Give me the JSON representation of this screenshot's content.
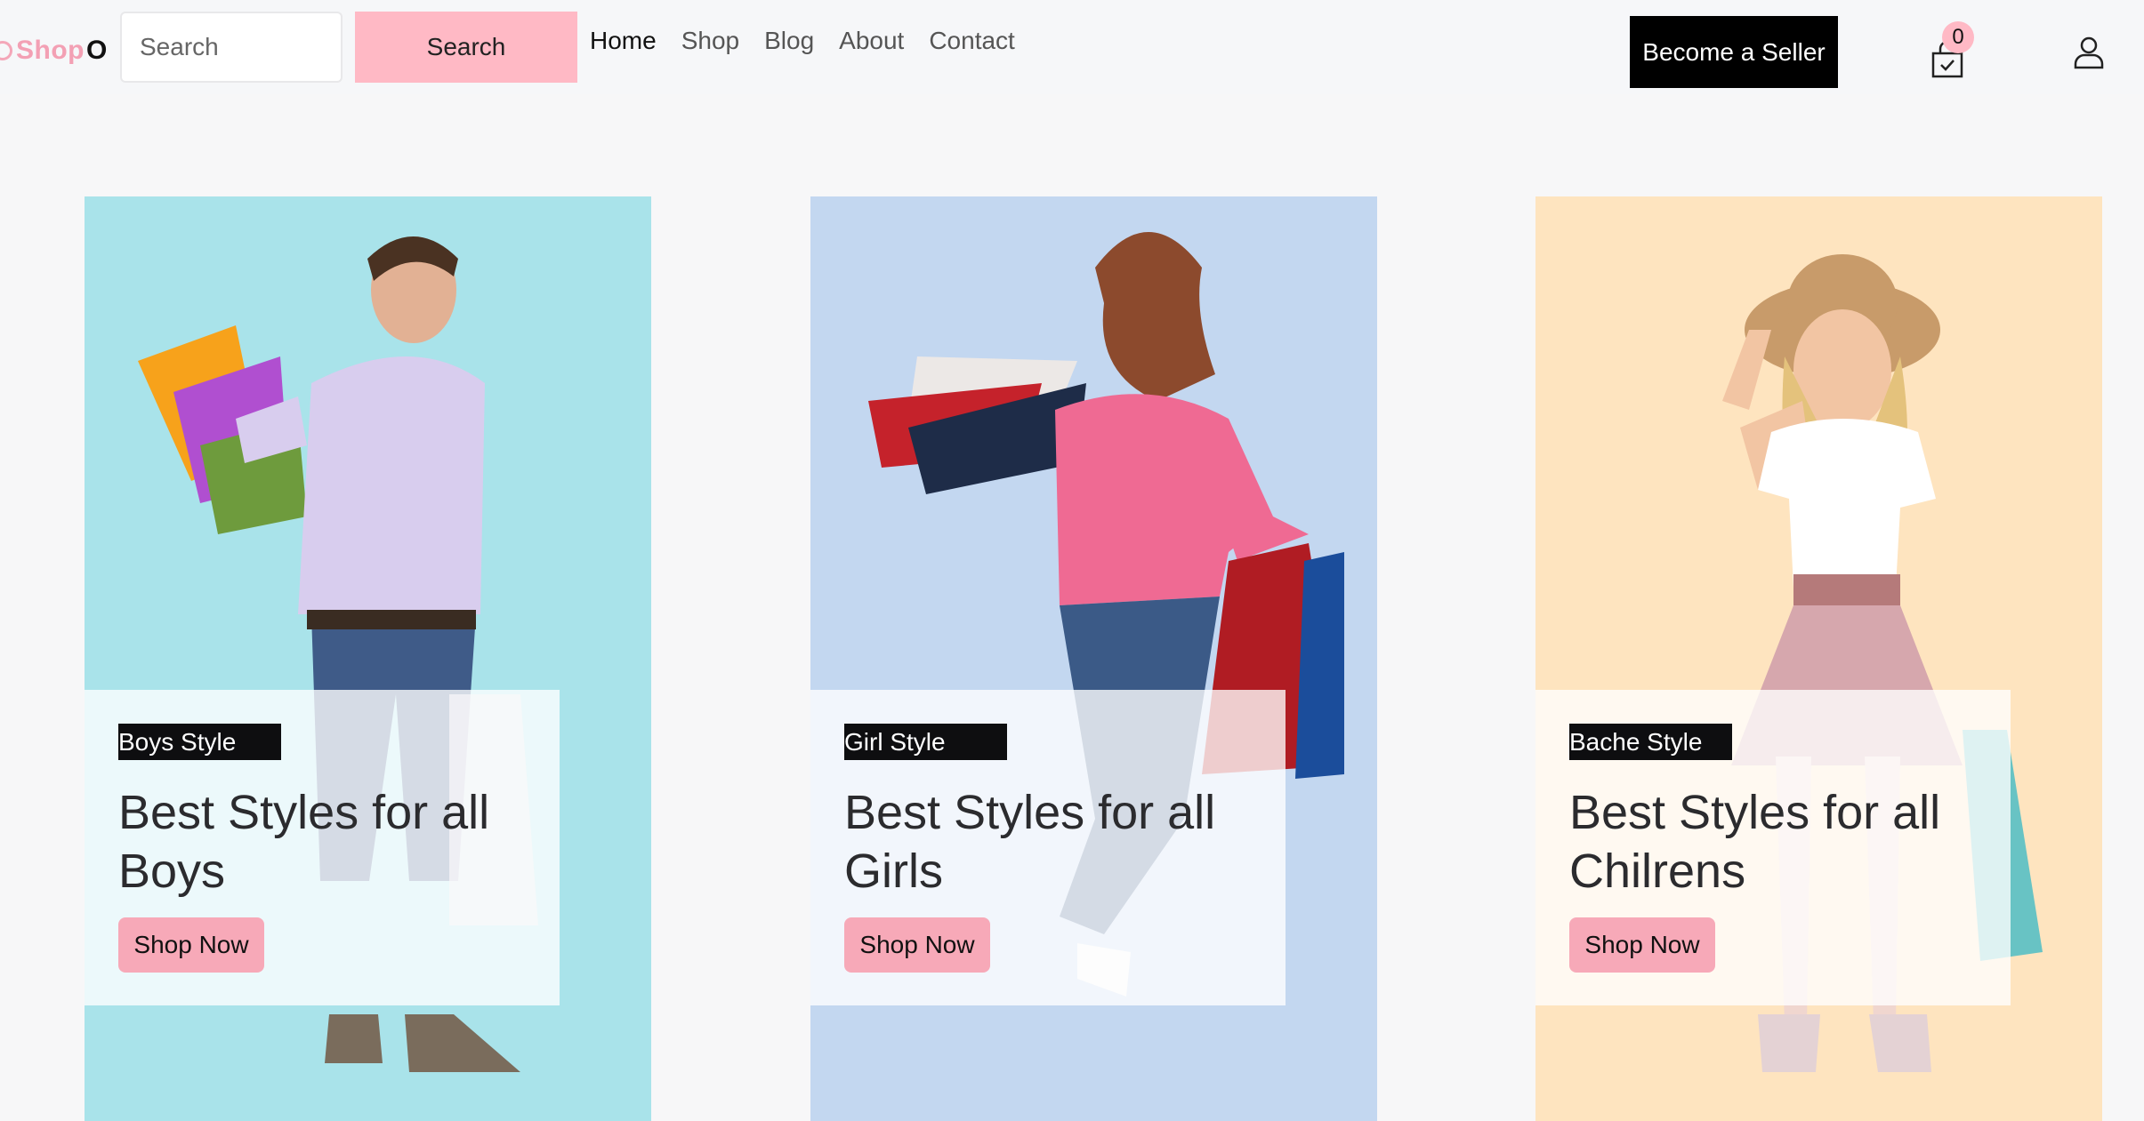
{
  "header": {
    "logo_shop": "Shop",
    "logo_o": "O",
    "search_placeholder": "Search",
    "search_button": "Search",
    "nav": [
      "Home",
      "Shop",
      "Blog",
      "About",
      "Contact"
    ],
    "active_nav": "Home",
    "seller_button": "Become a Seller",
    "cart_count": "0",
    "icons": {
      "cart": "cart-check-icon",
      "user": "user-icon"
    }
  },
  "cards": [
    {
      "tag": "Boys Style",
      "title": "Best Styles for all Boys",
      "cta": "Shop Now",
      "bg": "#a9e3ea"
    },
    {
      "tag": "Girl Style",
      "title": "Best Styles for all Girls",
      "cta": "Shop Now",
      "bg": "#c3d7f0"
    },
    {
      "tag": "Bache Style",
      "title": "Best Styles for all Chilrens",
      "cta": "Shop Now",
      "bg": "#fee4bf"
    }
  ],
  "colors": {
    "accent": "#ffb9c5",
    "dark": "#000000"
  }
}
